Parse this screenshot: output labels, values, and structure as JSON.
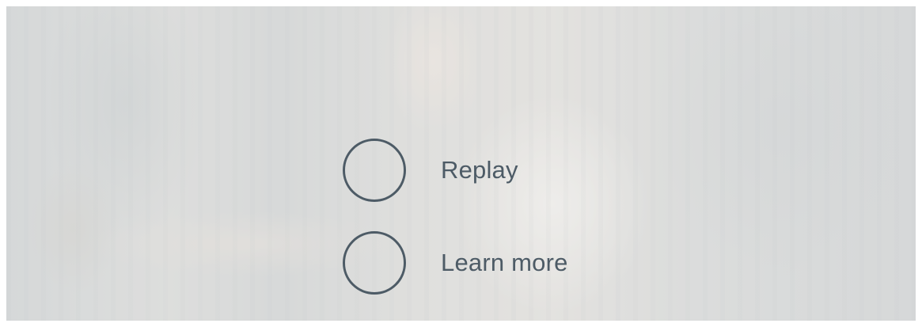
{
  "overlay": {
    "actions": [
      {
        "label": "Replay",
        "icon": "replay-circle-icon"
      },
      {
        "label": "Learn more",
        "icon": "learn-more-circle-icon"
      }
    ]
  },
  "colors": {
    "accent": "#4d5b66"
  }
}
